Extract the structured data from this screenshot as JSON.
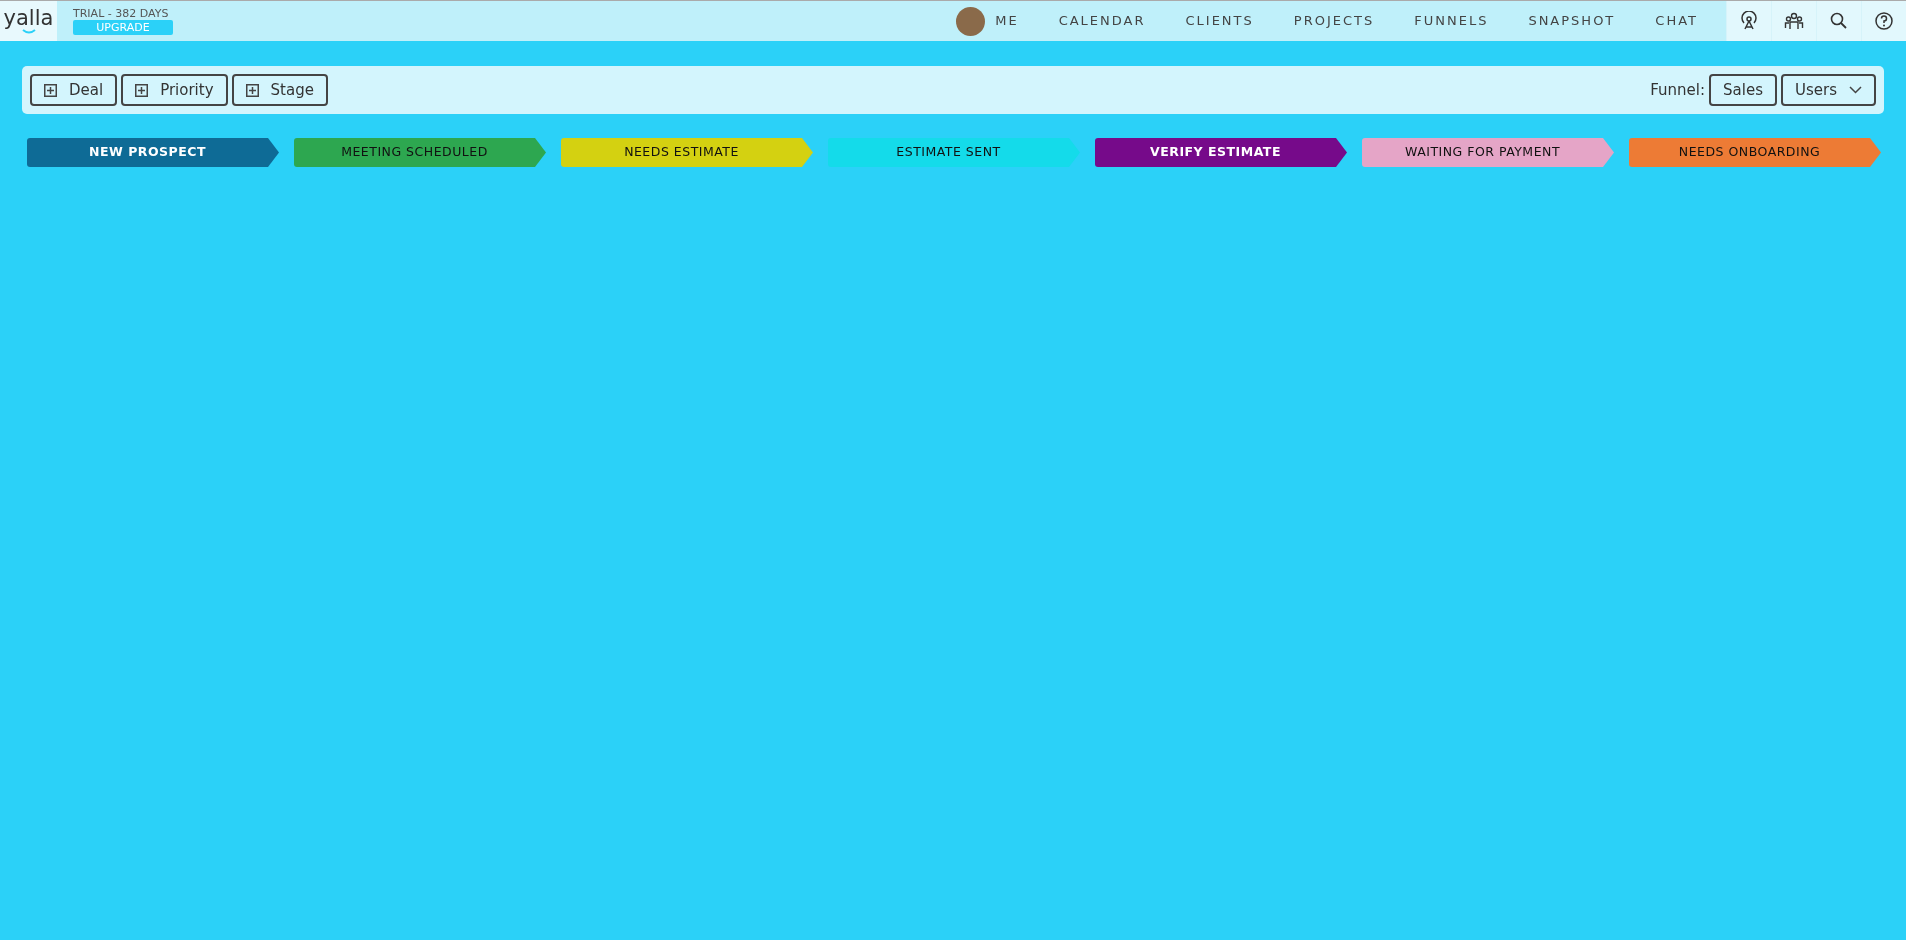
{
  "header": {
    "logo": "yalla",
    "trial": "TRIAL - 382 DAYS",
    "upgrade": "UPGRADE",
    "nav": [
      {
        "label": "ME",
        "kind": "avatar"
      },
      {
        "label": "CALENDAR",
        "kind": "link"
      },
      {
        "label": "CLIENTS",
        "kind": "link"
      },
      {
        "label": "PROJECTS",
        "kind": "link"
      },
      {
        "label": "FUNNELS",
        "kind": "link"
      },
      {
        "label": "SNAPSHOT",
        "kind": "link"
      },
      {
        "label": "CHAT",
        "kind": "link"
      }
    ],
    "icons": [
      {
        "kind": "broadcast"
      },
      {
        "kind": "team"
      },
      {
        "kind": "search"
      },
      {
        "kind": "help"
      }
    ]
  },
  "toolbar": {
    "add_buttons": [
      "Deal",
      "Priority",
      "Stage"
    ],
    "funnel_label": "Funnel:",
    "funnel": "Sales",
    "users": "Users"
  },
  "stages": [
    {
      "label": "NEW PROSPECT",
      "color": "#0e6b96"
    },
    {
      "label": "MEETING SCHEDULED",
      "color": "#2da750"
    },
    {
      "label": "NEEDS ESTIMATE",
      "color": "#d4d111"
    },
    {
      "label": "ESTIMATE SENT",
      "color": "#14dbea"
    },
    {
      "label": "VERIFY ESTIMATE",
      "color": "#760a8a"
    },
    {
      "label": "WAITING FOR PAYMENT",
      "color": "#e5a5c7"
    },
    {
      "label": "NEEDS ONBOARDING",
      "color": "#ed7b35"
    }
  ]
}
